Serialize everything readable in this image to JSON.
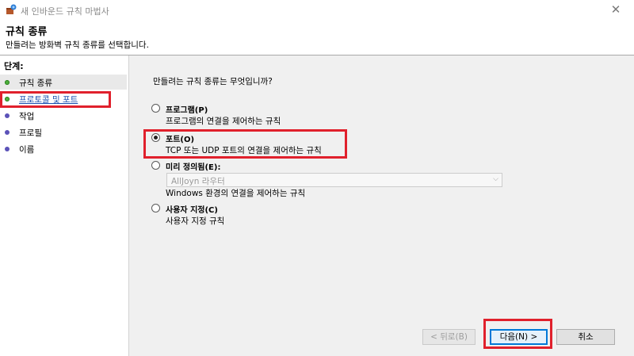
{
  "window": {
    "title": "새 인바운드 규칙 마법사",
    "close_glyph": "✕"
  },
  "header": {
    "title": "규칙 종류",
    "subtitle": "만들려는 방화벽 규칙 종류를 선택합니다."
  },
  "sidebar": {
    "heading": "단계:",
    "steps": [
      {
        "label": "규칙 종류",
        "state": "done"
      },
      {
        "label": "프로토콜 및 포트",
        "state": "link"
      },
      {
        "label": "작업",
        "state": "pending"
      },
      {
        "label": "프로필",
        "state": "pending"
      },
      {
        "label": "이름",
        "state": "pending"
      }
    ]
  },
  "main": {
    "question": "만들려는 규칙 종류는 무엇입니까?",
    "options": [
      {
        "title": "프로그램(P)",
        "desc": "프로그램의 연결을 제어하는 규칙",
        "checked": false
      },
      {
        "title": "포트(O)",
        "desc": "TCP 또는 UDP 포트의 연결을 제어하는 규칙",
        "checked": true
      },
      {
        "title": "미리 정의됨(E):",
        "desc": "Windows 환경의 연결을 제어하는 규칙",
        "checked": false
      },
      {
        "title": "사용자 지정(C)",
        "desc": "사용자 지정 규칙",
        "checked": false
      }
    ],
    "predefined_select": {
      "value": "AllJoyn 라우터",
      "arrow": "⌵",
      "disabled": true
    }
  },
  "buttons": {
    "back": "< 뒤로(B)",
    "next": "다음(N) >",
    "cancel": "취소"
  },
  "colors": {
    "highlight": "#e0202c",
    "accent": "#0078d7"
  }
}
